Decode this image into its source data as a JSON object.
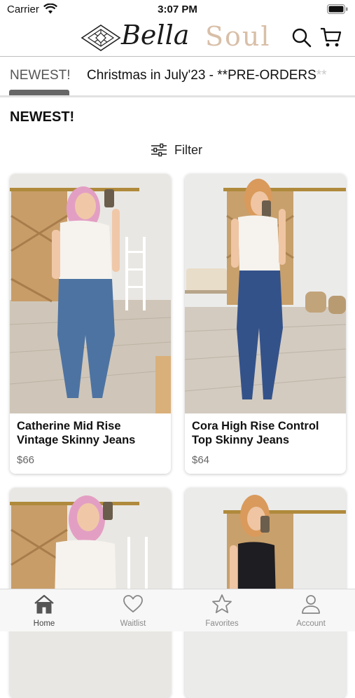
{
  "status_bar": {
    "carrier": "Carrier",
    "time": "3:07 PM"
  },
  "brand": {
    "script": "Bella",
    "word": "Soul"
  },
  "tabs": [
    {
      "label": "NEWEST!"
    },
    {
      "label": "Christmas in July'23 - **PRE-ORDERS",
      "tail": "**"
    }
  ],
  "section": {
    "title": "NEWEST!"
  },
  "filter": {
    "label": "Filter"
  },
  "products": [
    {
      "name": "Catherine Mid Rise Vintage Skinny Jeans",
      "price": "$66"
    },
    {
      "name": "Cora High Rise Control Top Skinny Jeans",
      "price": "$64"
    },
    {
      "name": "",
      "price": ""
    },
    {
      "name": "",
      "price": ""
    }
  ],
  "bottom_nav": [
    {
      "label": "Home",
      "icon": "home-icon"
    },
    {
      "label": "Waitlist",
      "icon": "heart-icon"
    },
    {
      "label": "Favorites",
      "icon": "star-icon"
    },
    {
      "label": "Account",
      "icon": "person-icon"
    }
  ],
  "colors": {
    "brand_soul": "#d8bfa8",
    "active_tab": "#666666",
    "price": "#666666"
  }
}
